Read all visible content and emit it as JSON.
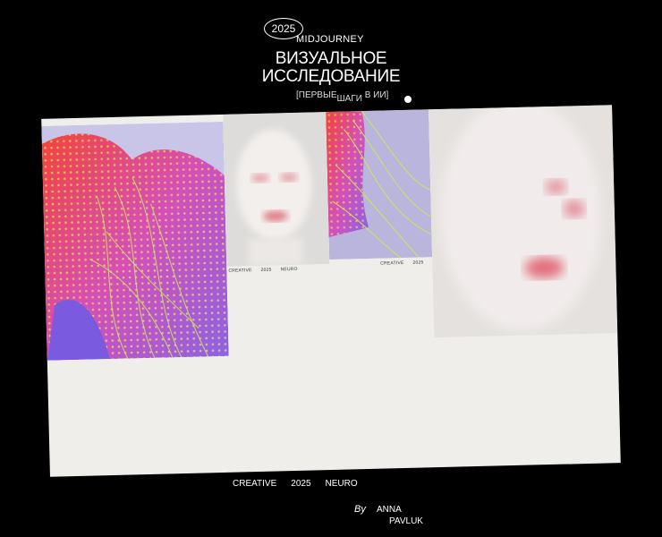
{
  "header": {
    "year": "2025",
    "brand": "MIDJOURNEY",
    "title_line1": "ВИЗУАЛЬНОЕ",
    "title_line2": "ИССЛЕДОВАНИЕ",
    "subtitle_part1": "[ПЕРВЫЕ",
    "subtitle_part2": "ШАГИ",
    "subtitle_part3": "В ИИ]"
  },
  "card_caption": {
    "a": "CREATIVE",
    "b": "2025",
    "c": "NEURO"
  },
  "footer": {
    "tag1": "CREATIVE",
    "tag2": "2025",
    "tag3": "NEURO",
    "by": "By",
    "author_first": "ANNA",
    "author_last": "PAVLUK"
  },
  "colors": {
    "background": "#000000",
    "board": "#efeeeb",
    "accent_red": "#f2443a",
    "accent_violet": "#8a63e8",
    "accent_lime": "#c9e85a"
  }
}
